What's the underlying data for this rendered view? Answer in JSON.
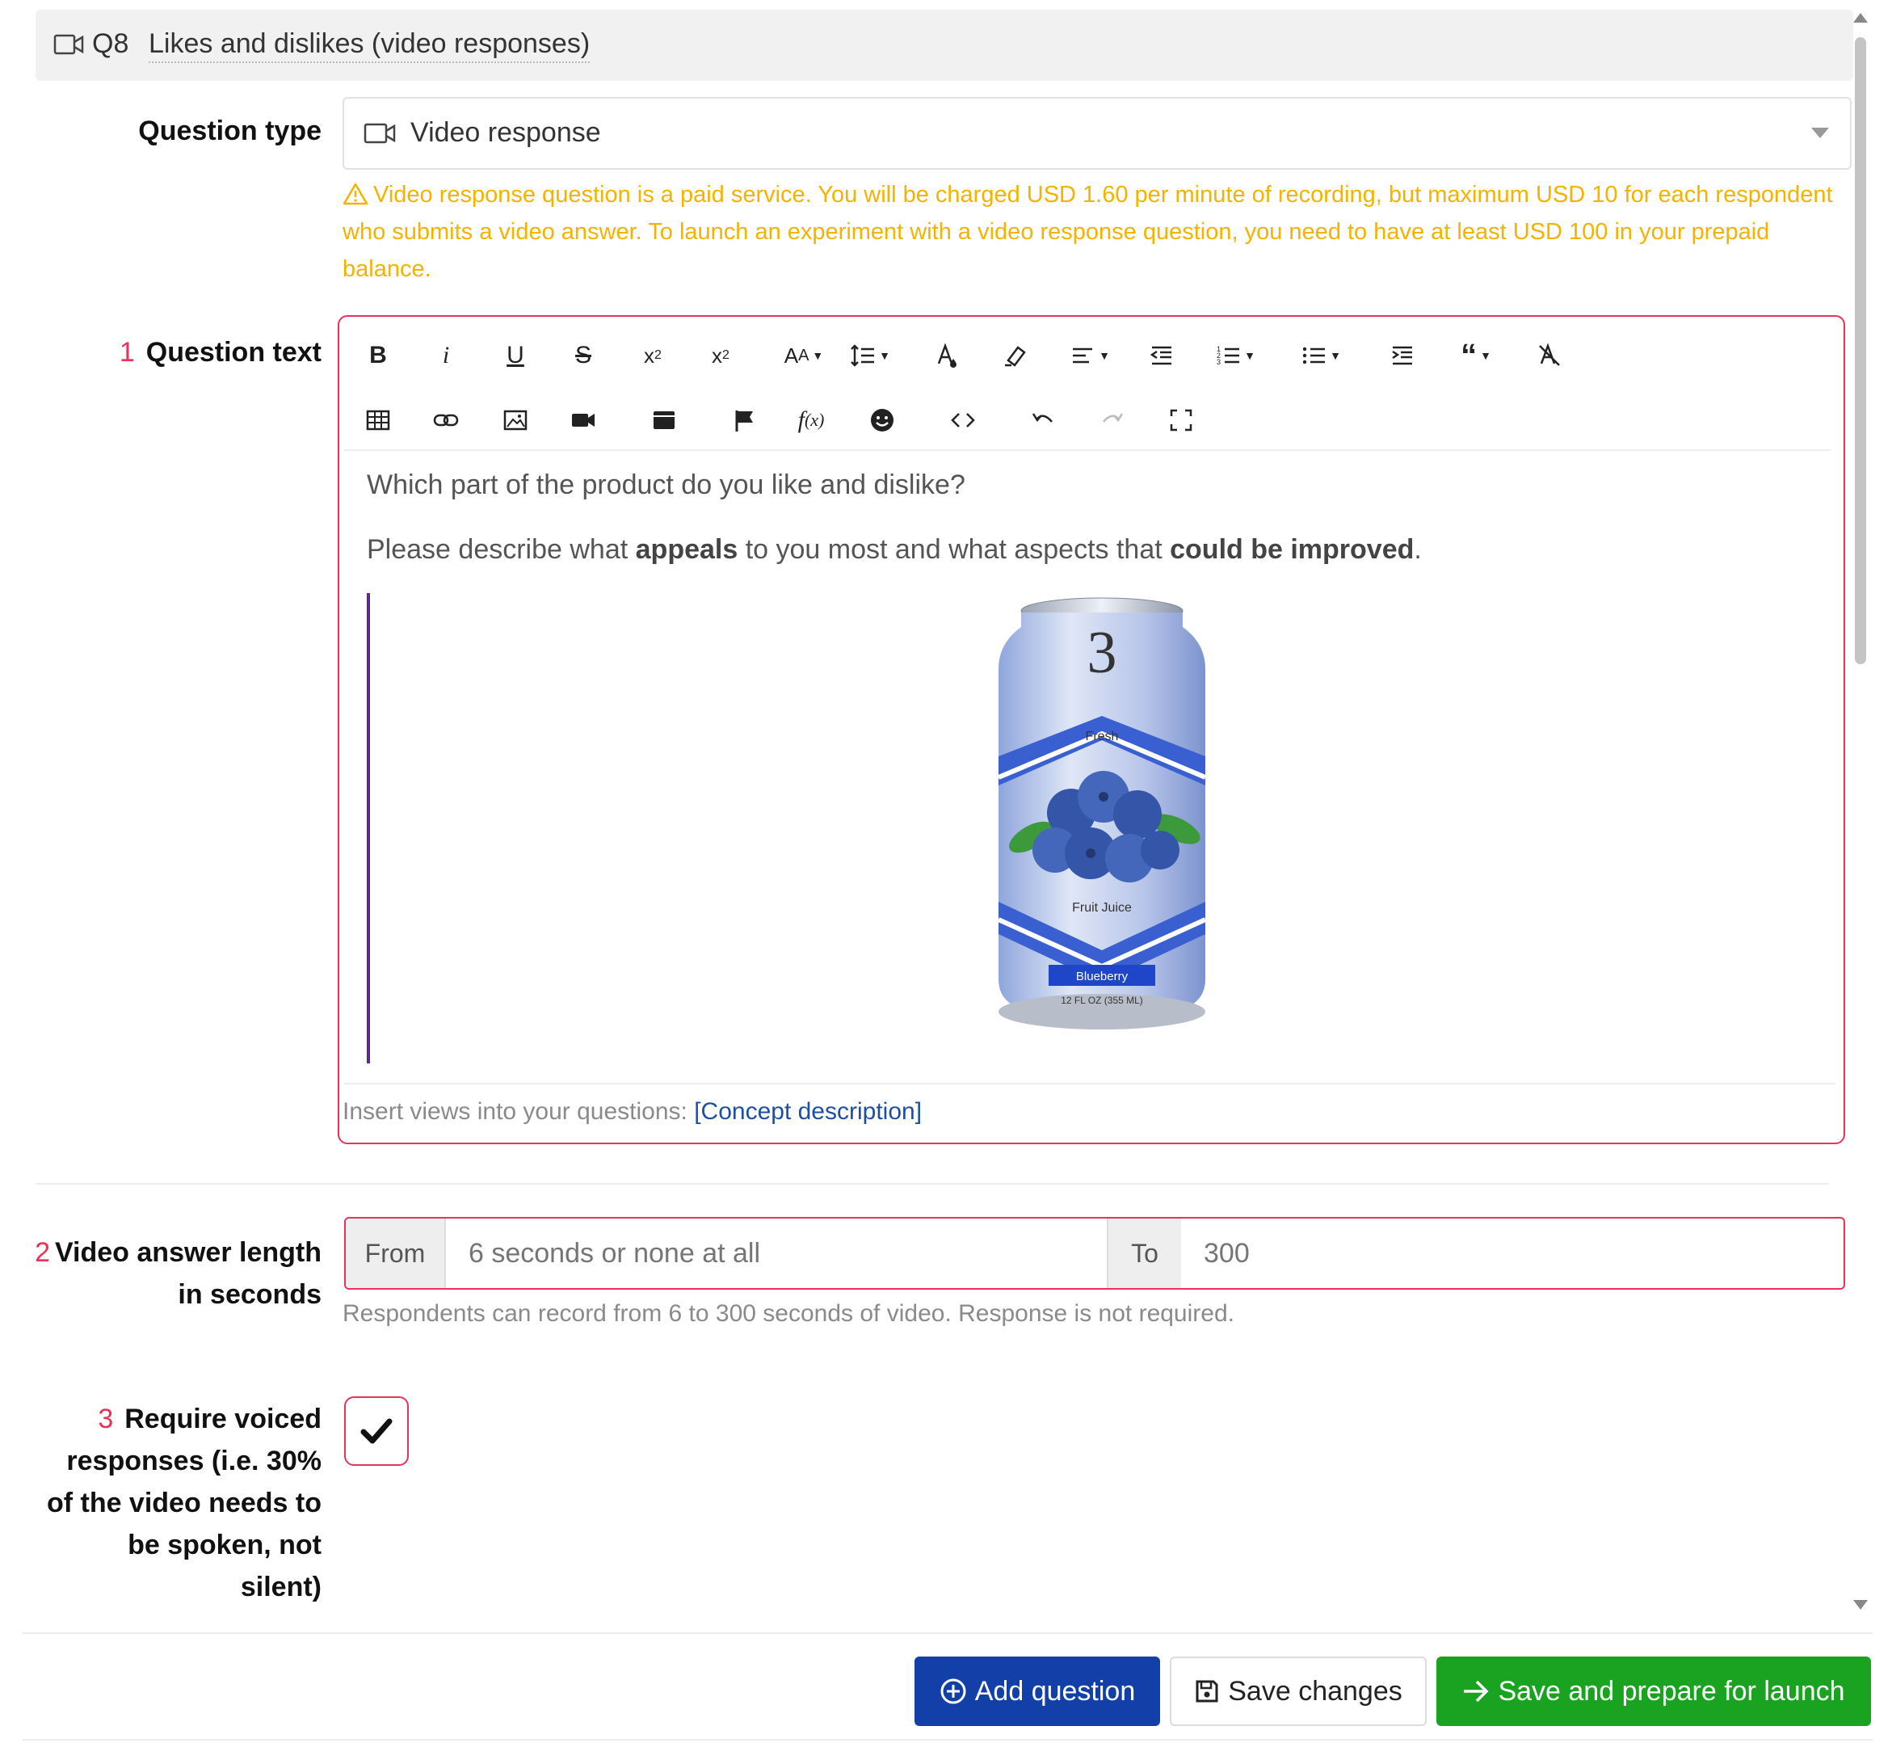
{
  "question_header": {
    "number": "Q8",
    "title": "Likes and dislikes (video responses)",
    "icon": "video-camera-icon"
  },
  "question_type": {
    "label": "Question type",
    "value": "Video response",
    "warning": "Video response question is a paid service. You will be charged USD 1.60 per minute of recording, but maximum USD 10 for each respondent who submits a video answer. To launch an experiment with a video response question, you need to have at least USD 100 in your prepaid balance."
  },
  "question_text": {
    "number": "1",
    "label": "Question text",
    "line1": "Which part of the product do you like and dislike?",
    "line2_parts": [
      "Please describe what ",
      "appeals",
      " to you most and what aspects that ",
      "could be improved",
      "."
    ],
    "insert_prefix": "Insert views into your questions:",
    "insert_link": "[Concept description]",
    "image": {
      "brand_mark": "3",
      "top_text": "Fresh",
      "middle_text": "Fruit Juice",
      "flavor": "Blueberry",
      "volume": "12 FL OZ (355 ML)"
    }
  },
  "toolbar": {
    "row1": [
      "bold",
      "italic",
      "underline",
      "strikethrough",
      "subscript",
      "superscript",
      "font-size",
      "line-height",
      "text-color",
      "highlight",
      "align",
      "outdent",
      "ordered-list",
      "unordered-list",
      "indent",
      "quote",
      "clear-format"
    ],
    "row2": [
      "table",
      "link",
      "image",
      "video",
      "media",
      "flag",
      "formula",
      "emoji",
      "code-view",
      "undo",
      "redo",
      "fullscreen"
    ]
  },
  "video_length": {
    "number": "2",
    "label_line1": "Video answer length",
    "label_line2": "in seconds",
    "from_label": "From",
    "from_placeholder": "6 seconds or none at all",
    "to_label": "To",
    "to_value": "300",
    "hint": "Respondents can record from 6 to 300 seconds of video. Response is not required."
  },
  "voiced": {
    "number": "3",
    "label_lines": [
      "Require voiced",
      "responses (i.e. 30%",
      "of the video needs to",
      "be spoken, not",
      "silent)"
    ],
    "checked": true
  },
  "footer": {
    "add_question": "Add question",
    "save_changes": "Save changes",
    "save_launch": "Save and prepare for launch"
  },
  "colors": {
    "accent_red": "#e8325a",
    "warning": "#f3b300",
    "primary": "#1240a8",
    "success": "#1aa320",
    "link": "#1f4fa3"
  }
}
